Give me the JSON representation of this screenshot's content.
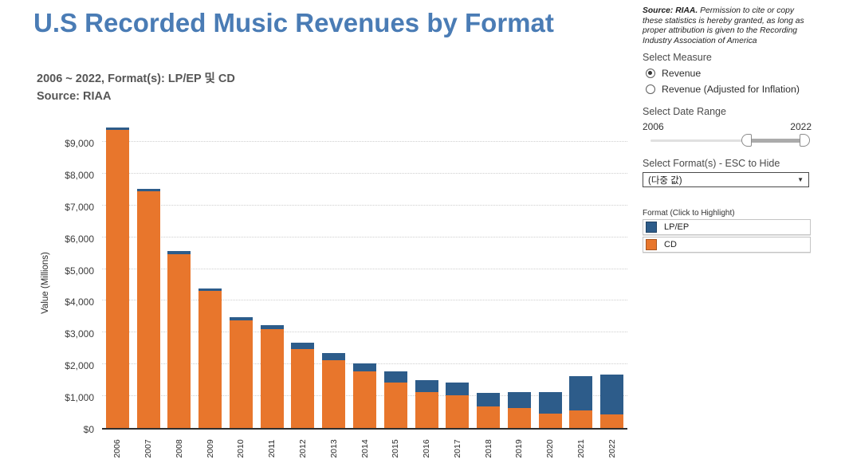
{
  "title": "U.S Recorded Music Revenues by Format",
  "subtitle_line1": "2006 ~ 2022, Format(s): LP/EP 및 CD",
  "subtitle_line2": "Source: RIAA",
  "colors": {
    "title_blue": "#4A7CB5",
    "cd_orange": "#E8762C",
    "lp_blue": "#2D5C8A"
  },
  "side_panel": {
    "attribution_bold": "Source: RIAA.",
    "attribution_rest": " Permission to cite or copy these statistics is hereby granted, as long as proper attribution is given to the Recording Industry Association of America",
    "select_measure_label": "Select Measure",
    "measure_options": [
      {
        "label": "Revenue",
        "selected": true
      },
      {
        "label": "Revenue (Adjusted for Inflation)",
        "selected": false
      }
    ],
    "date_range": {
      "label": "Select Date Range",
      "min": "2006",
      "max": "2022",
      "handle_left_pct": 61,
      "handle_right_pct": 97
    },
    "format_filter": {
      "label": "Select Format(s) - ESC to Hide",
      "value": "(다중 값)",
      "caret": "▼"
    },
    "legend": {
      "label": "Format (Click to Highlight)",
      "items": [
        {
          "label": "LP/EP",
          "color": "#2D5C8A"
        },
        {
          "label": "CD",
          "color": "#E8762C"
        }
      ]
    }
  },
  "chart_data": {
    "type": "bar",
    "stacked": true,
    "title": "U.S Recorded Music Revenues by Format",
    "ylabel": "Value (Millions)",
    "xlabel": "",
    "categories": [
      "2006",
      "2007",
      "2008",
      "2009",
      "2010",
      "2011",
      "2012",
      "2013",
      "2014",
      "2015",
      "2016",
      "2017",
      "2018",
      "2019",
      "2020",
      "2021",
      "2022"
    ],
    "series": [
      {
        "name": "CD",
        "color": "#E8762C",
        "values": [
          9370,
          7450,
          5470,
          4320,
          3390,
          3100,
          2480,
          2120,
          1790,
          1420,
          1130,
          1020,
          670,
          620,
          440,
          550,
          420
        ]
      },
      {
        "name": "LP/EP",
        "color": "#2D5C8A",
        "values": [
          90,
          80,
          100,
          70,
          90,
          140,
          190,
          230,
          230,
          370,
          370,
          410,
          430,
          500,
          690,
          1090,
          1260
        ]
      }
    ],
    "ylim": [
      0,
      9500
    ],
    "ytick_step": 1000,
    "ytick_prefix": "$",
    "grid": "horizontal-dotted",
    "legend_position": "right-panel"
  }
}
